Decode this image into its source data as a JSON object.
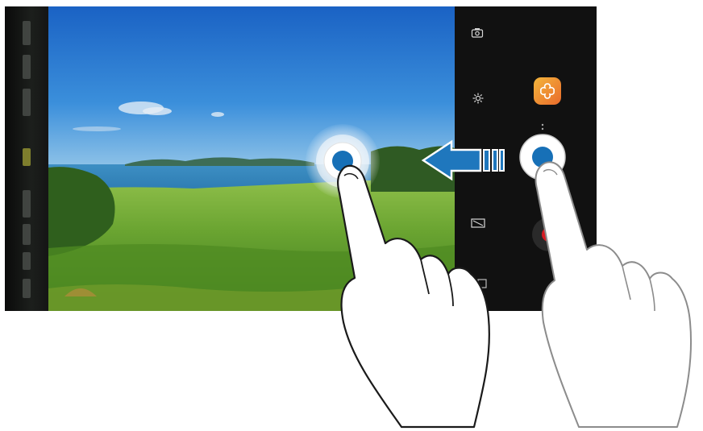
{
  "camera": {
    "mode_strip": {
      "items": [
        "mode-1",
        "mode-2",
        "mode-3",
        "mode-4",
        "mode-5",
        "mode-6",
        "mode-7",
        "mode-8"
      ],
      "active_index": 3
    },
    "controls": {
      "icons": [
        "switch-camera-icon",
        "settings-icon",
        "aspect-ratio-icon",
        "gallery-icon"
      ],
      "effect_button_icon": "flower-effect-icon",
      "shutter_button_icon": "shutter-button",
      "record_button_icon": "record-icon"
    },
    "gesture": {
      "direction": "left",
      "description_icons": [
        "arrow-left-icon",
        "touch-point-icon",
        "hand-pointer-icon"
      ]
    }
  },
  "colors": {
    "accent_blue": "#1770b7",
    "record_red": "#d81c24",
    "effect_orange": "#ef8a34",
    "sky_blue": "#3a8ad8",
    "grass_green": "#5f9a2c"
  }
}
